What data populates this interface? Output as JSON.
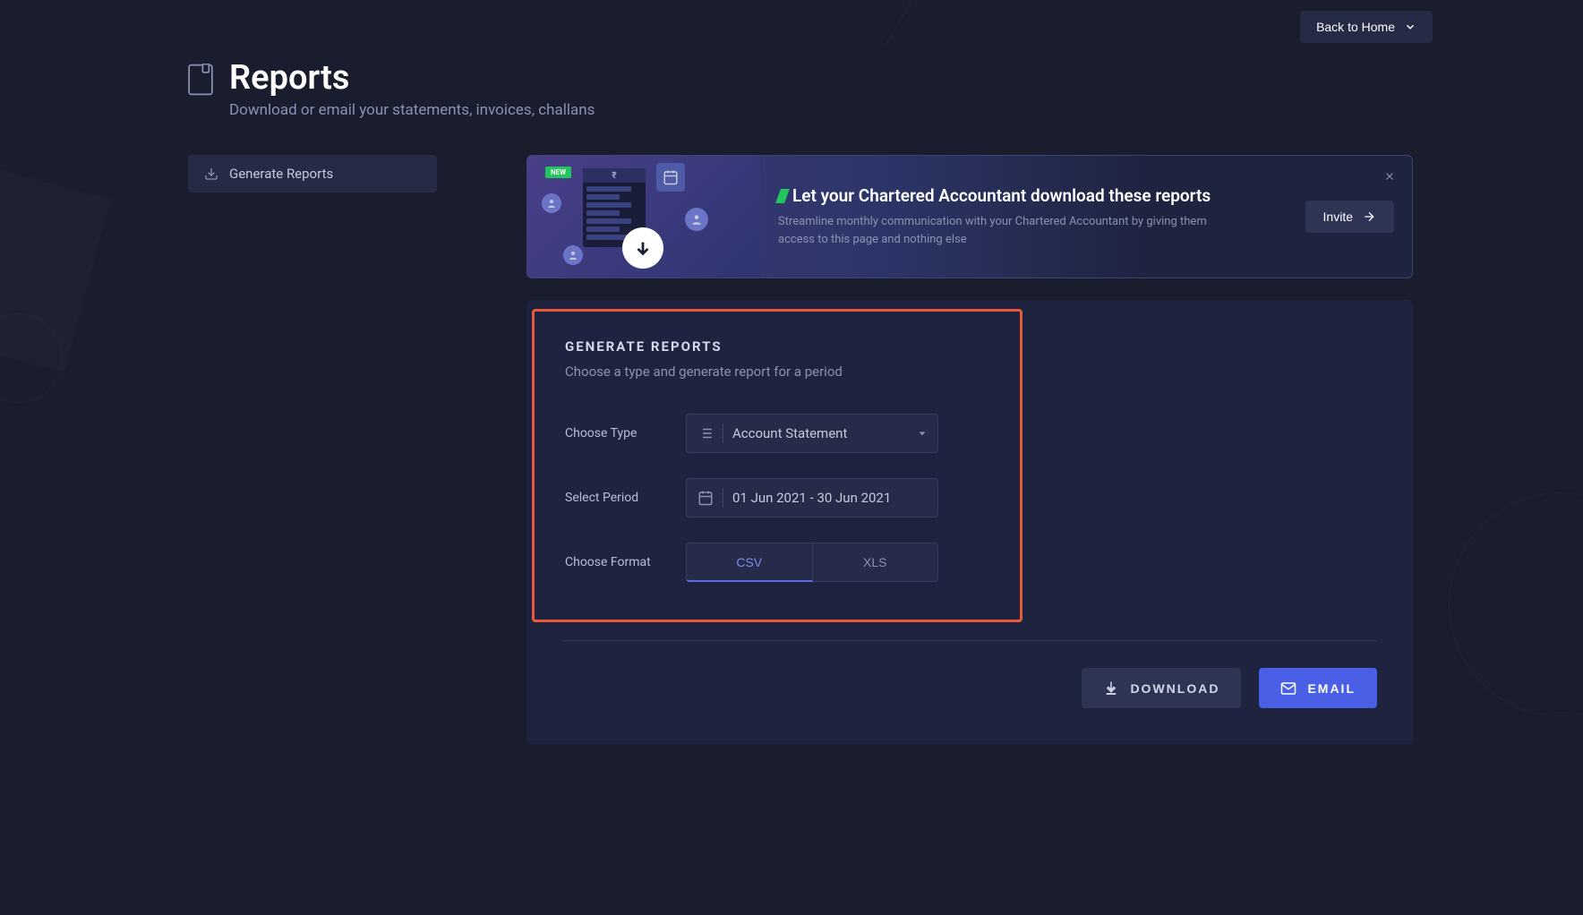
{
  "header": {
    "back_button": "Back to Home",
    "title": "Reports",
    "subtitle": "Download or email your statements, invoices, challans"
  },
  "sidebar": {
    "items": [
      {
        "label": "Generate Reports"
      }
    ]
  },
  "banner": {
    "badge": "NEW",
    "rupee_symbol": "₹",
    "title": "Let your Chartered Accountant download these reports",
    "description": "Streamline monthly communication with your Chartered Accountant by giving them access to this page and nothing else",
    "invite_label": "Invite"
  },
  "form": {
    "section_title": "GENERATE REPORTS",
    "section_subtitle": "Choose a type and generate report for a period",
    "type_label": "Choose Type",
    "type_value": "Account Statement",
    "period_label": "Select Period",
    "period_value": "01 Jun 2021  - 30 Jun 2021",
    "format_label": "Choose Format",
    "format_csv": "CSV",
    "format_xls": "XLS",
    "selected_format": "CSV"
  },
  "actions": {
    "download_label": "DOWNLOAD",
    "email_label": "EMAIL"
  }
}
